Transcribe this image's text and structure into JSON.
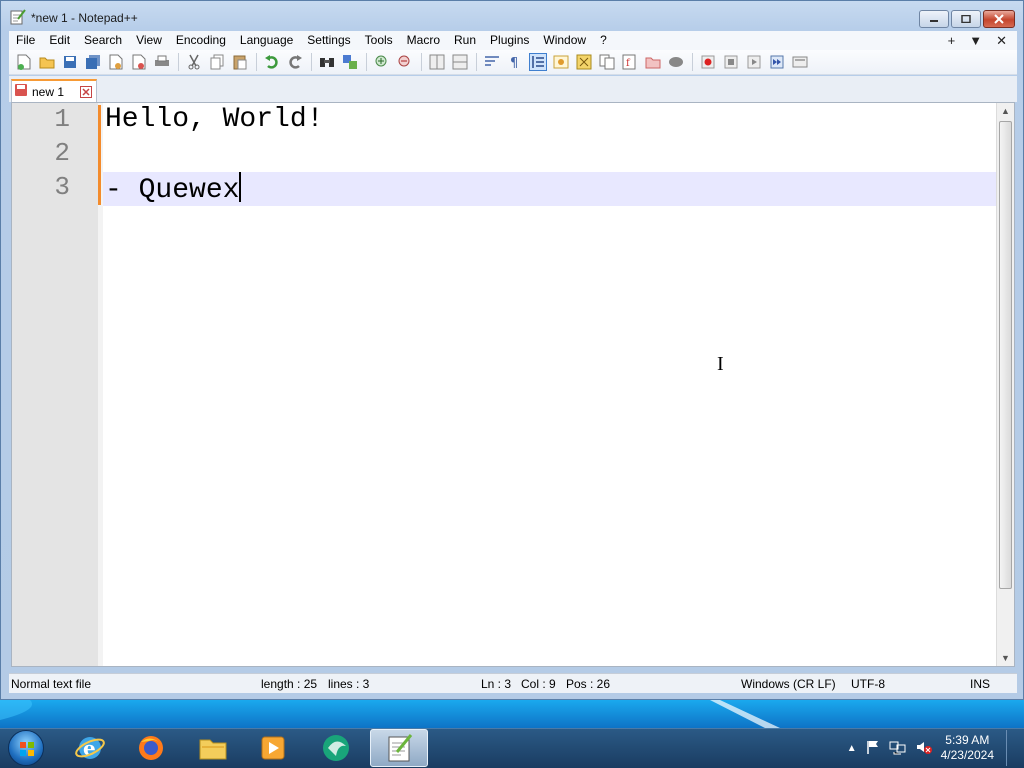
{
  "window": {
    "title": "*new 1 - Notepad++"
  },
  "menu": {
    "items": [
      "File",
      "Edit",
      "Search",
      "View",
      "Encoding",
      "Language",
      "Settings",
      "Tools",
      "Macro",
      "Run",
      "Plugins",
      "Window",
      "?"
    ],
    "right": [
      "+",
      "▼",
      "✕"
    ]
  },
  "toolbar": {
    "icons": [
      "new-file-icon",
      "open-file-icon",
      "save-icon",
      "save-all-icon",
      "close-icon",
      "close-all-icon",
      "print-icon",
      "cut-icon",
      "copy-icon",
      "paste-icon",
      "undo-icon",
      "redo-icon",
      "find-icon",
      "replace-icon",
      "zoom-in-icon",
      "zoom-out-icon",
      "sync-vertical-icon",
      "sync-horizontal-icon",
      "word-wrap-icon",
      "show-all-chars-icon",
      "indent-guide-icon",
      "udl-icon",
      "doc-map-icon",
      "document-list-icon",
      "function-list-icon",
      "folder-as-workspace-icon",
      "monitoring-icon",
      "record-macro-icon",
      "stop-macro-icon",
      "play-macro-icon",
      "run-macro-multiple-icon",
      "save-macro-icon"
    ]
  },
  "tab": {
    "label": "new 1"
  },
  "editor": {
    "lines": [
      {
        "number": "1",
        "text": "Hello, World!"
      },
      {
        "number": "2",
        "text": ""
      },
      {
        "number": "3",
        "text": "- Quewex"
      }
    ],
    "current_line": 3
  },
  "status": {
    "file_type": "Normal text file",
    "length": "length : 25",
    "lines": "lines : 3",
    "ln": "Ln : 3",
    "col": "Col : 9",
    "pos": "Pos : 26",
    "eol": "Windows (CR LF)",
    "encoding": "UTF-8",
    "mode": "INS"
  },
  "taskbar": {
    "time": "5:39 AM",
    "date": "4/23/2024"
  },
  "colors": {
    "current_line_bg": "#e8e8ff",
    "change_bar": "#f38b2c",
    "tab_accent": "#f79a35"
  }
}
